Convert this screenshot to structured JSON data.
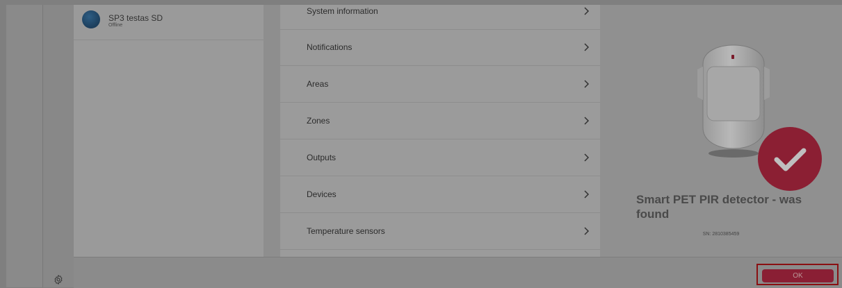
{
  "device_list": {
    "items": [
      {
        "name": "SP3 testas SD",
        "status": "Offline"
      }
    ]
  },
  "menu": {
    "items": [
      {
        "label": "System information"
      },
      {
        "label": "Notifications"
      },
      {
        "label": "Areas"
      },
      {
        "label": "Zones"
      },
      {
        "label": "Outputs"
      },
      {
        "label": "Devices"
      },
      {
        "label": "Temperature sensors"
      }
    ]
  },
  "found_panel": {
    "title": "Smart PET PIR detector - was found",
    "serial": "SN: 2810385459"
  },
  "footer": {
    "ok_label": "OK"
  },
  "colors": {
    "overlay": "#7f7f7f",
    "accent": "#8a1f34",
    "highlight_frame": "#8a0f12"
  },
  "icons": [
    "settings-icon",
    "chevron-right-icon",
    "checkmark-icon"
  ]
}
